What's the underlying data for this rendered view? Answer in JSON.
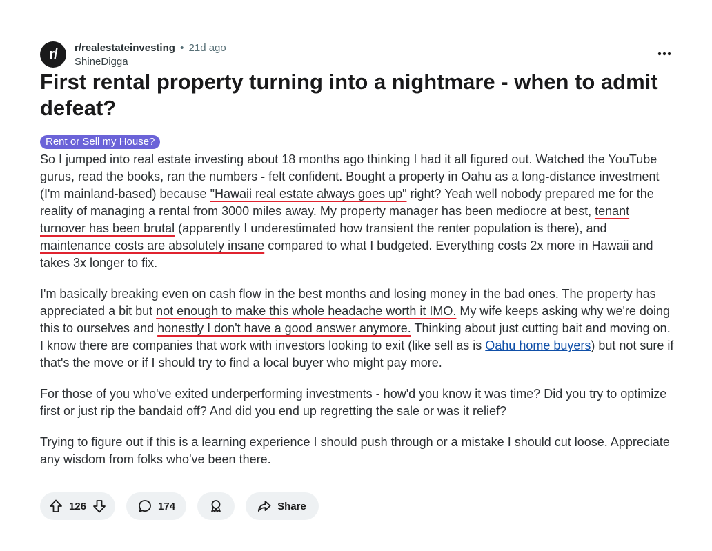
{
  "header": {
    "avatar_text": "r/",
    "subreddit": "r/realestateinvesting",
    "separator": "•",
    "time": "21d ago",
    "username": "ShineDigga",
    "more_icon": "ellipsis-icon"
  },
  "post": {
    "title": "First rental property turning into a nightmare - when to admit defeat?",
    "flair": "Rent or Sell my House?",
    "p1": {
      "a": "So I jumped into real estate investing about 18 months ago thinking I had it all figured out. Watched the YouTube gurus, read the books, ran the numbers - felt confident. Bought a property in Oahu as a long-distance investment (I'm mainland-based) because ",
      "u1": "\"Hawaii real estate always goes up\"",
      "b": " right? Yeah well nobody prepared me for the reality of managing a rental from 3000 miles away. My property manager has been mediocre at best, ",
      "u2": "tenant turnover has been brutal",
      "c": " (apparently I underestimated how transient the renter population is there), and ",
      "u3": "maintenance costs are absolutely insane",
      "d": " compared to what I budgeted. Everything costs 2x more in Hawaii and takes 3x longer to fix."
    },
    "p2": {
      "a": "I'm basically breaking even on cash flow in the best months and losing money in the bad ones. The property has appreciated a bit but ",
      "u1": "not enough to make this whole headache worth it IMO.",
      "b": " My wife keeps asking why we're doing this to ourselves and ",
      "u2": "honestly I don't have a good answer anymore.",
      "c": " Thinking about just cutting bait and moving on. I know there are companies that work with investors looking to exit (like sell as is ",
      "link": "Oahu home buyers",
      "d": ") but not sure if that's the move or if I should try to find a local buyer who might pay more."
    },
    "p3": "For those of you who've exited underperforming investments - how'd you know it was time? Did you try to optimize first or just rip the bandaid off? And did you end up regretting the sale or was it relief?",
    "p4": "Trying to figure out if this is a learning experience I should push through or a mistake I should cut loose. Appreciate any wisdom from folks who've been there."
  },
  "actions": {
    "votes": "126",
    "comments": "174",
    "share_label": "Share",
    "upvote_icon": "upvote-icon",
    "downvote_icon": "downvote-icon",
    "comment_icon": "comment-icon",
    "award_icon": "award-icon",
    "share_icon": "share-icon"
  },
  "colors": {
    "flair_bg": "#6b63d8",
    "underline": "#e0232f",
    "link": "#0f4fa8",
    "pill_bg": "#eef1f3"
  }
}
